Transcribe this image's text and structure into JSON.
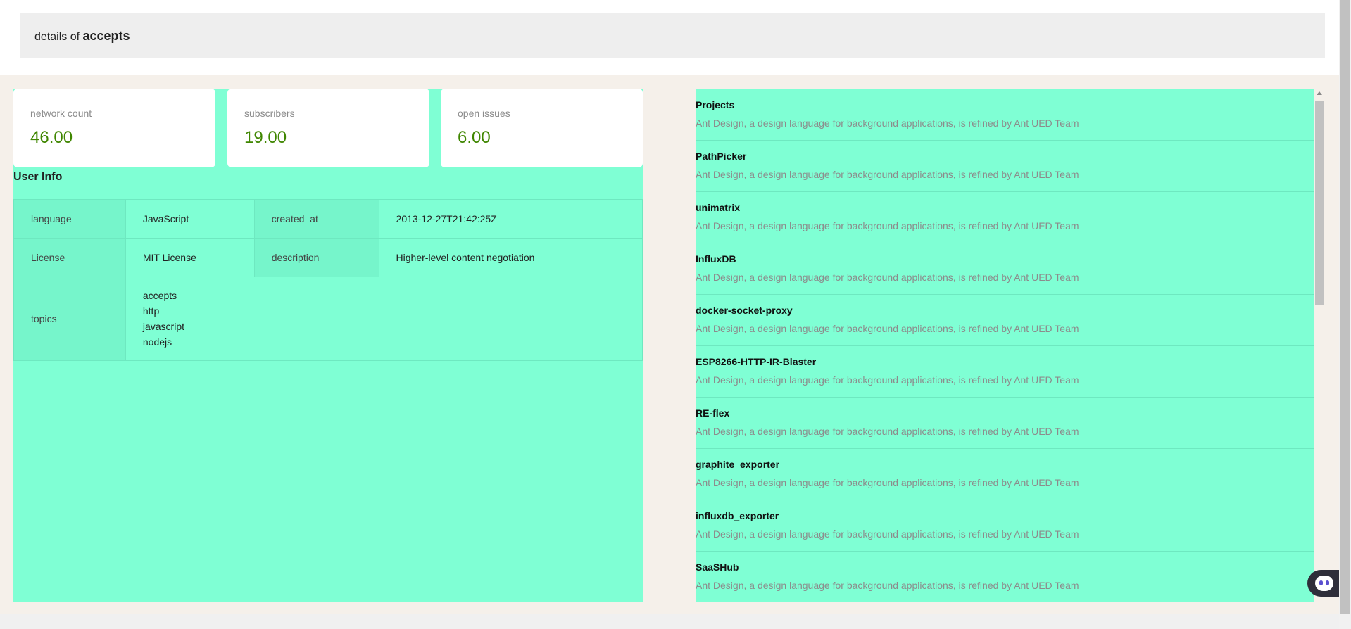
{
  "header": {
    "prefix": "details of",
    "repo_name": "accepts"
  },
  "stats": [
    {
      "label": "network count",
      "value": "46.00"
    },
    {
      "label": "subscribers",
      "value": "19.00"
    },
    {
      "label": "open issues",
      "value": "6.00"
    }
  ],
  "user_info": {
    "title": "User Info",
    "language_label": "language",
    "language_value": "JavaScript",
    "created_at_label": "created_at",
    "created_at_value": "2013-12-27T21:42:25Z",
    "license_label": "License",
    "license_value": "MIT License",
    "description_label": "description",
    "description_value": "Higher-level content negotiation",
    "topics_label": "topics",
    "topics": [
      "accepts",
      "http",
      "javascript",
      "nodejs"
    ]
  },
  "projects": [
    {
      "title": "Projects",
      "description": "Ant Design, a design language for background applications, is refined by Ant UED Team"
    },
    {
      "title": "PathPicker",
      "description": "Ant Design, a design language for background applications, is refined by Ant UED Team"
    },
    {
      "title": "unimatrix",
      "description": "Ant Design, a design language for background applications, is refined by Ant UED Team"
    },
    {
      "title": "InfluxDB",
      "description": "Ant Design, a design language for background applications, is refined by Ant UED Team"
    },
    {
      "title": "docker-socket-proxy",
      "description": "Ant Design, a design language for background applications, is refined by Ant UED Team"
    },
    {
      "title": "ESP8266-HTTP-IR-Blaster",
      "description": "Ant Design, a design language for background applications, is refined by Ant UED Team"
    },
    {
      "title": "RE-flex",
      "description": "Ant Design, a design language for background applications, is refined by Ant UED Team"
    },
    {
      "title": "graphite_exporter",
      "description": "Ant Design, a design language for background applications, is refined by Ant UED Team"
    },
    {
      "title": "influxdb_exporter",
      "description": "Ant Design, a design language for background applications, is refined by Ant UED Team"
    },
    {
      "title": "SaaSHub",
      "description": "Ant Design, a design language for background applications, is refined by Ant UED Team"
    }
  ],
  "colors": {
    "panel_bg": "#7fffd4",
    "stat_value": "#3f8600",
    "muted_text": "#8c8c8c",
    "page_bg": "#f5f0ea"
  },
  "icons": {
    "assistant": "robot-face-icon",
    "scroll_up": "triangle-up-icon"
  }
}
